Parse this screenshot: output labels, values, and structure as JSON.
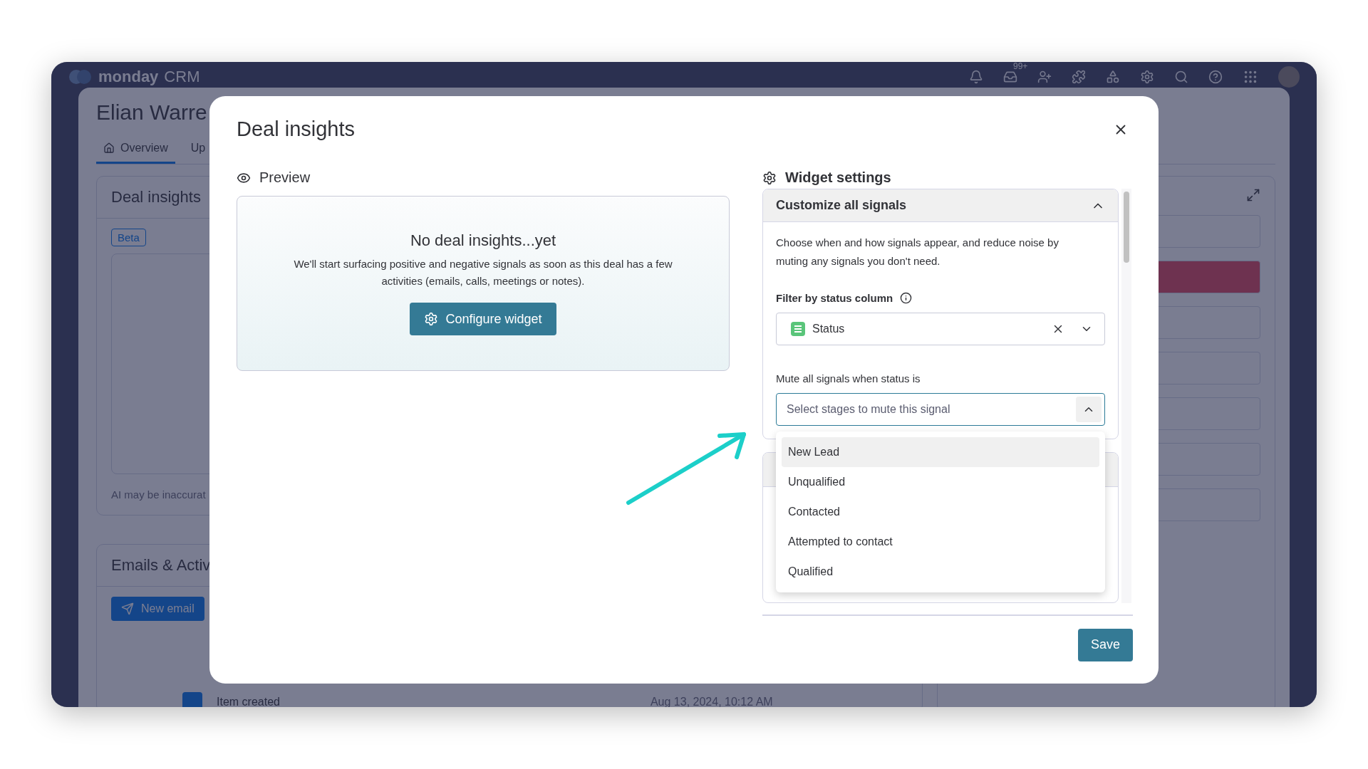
{
  "app": {
    "logo": "monday",
    "product": "CRM",
    "notification_count": "99+",
    "item_title": "Elian Warre",
    "tabs": [
      {
        "label": "Overview",
        "selected": true
      },
      {
        "label": "Up",
        "selected": false
      }
    ],
    "deal_card": {
      "title": "Deal insights",
      "badge": "Beta",
      "disclaimer": "AI may be inaccurat"
    },
    "emails_card": {
      "title": "Emails & Activ",
      "button": "New email",
      "activity": {
        "text": "Item created",
        "time": "Aug 13, 2024, 10:12 AM"
      }
    }
  },
  "modal": {
    "title": "Deal insights",
    "preview": {
      "label": "Preview",
      "empty_title": "No deal insights...yet",
      "empty_text": "We'll start surfacing positive and negative signals as soon as this deal has a few activities (emails, calls, meetings or notes).",
      "button": "Configure widget"
    },
    "settings": {
      "label": "Widget settings",
      "section": {
        "title": "Customize all signals",
        "expanded": true,
        "description": "Choose when and how signals appear, and reduce noise by muting any signals you don't need.",
        "filter": {
          "label": "Filter by status column",
          "value": "Status"
        },
        "mute": {
          "label": "Mute all signals when status is",
          "placeholder": "Select stages to mute this signal",
          "open": true,
          "options": [
            {
              "label": "New Lead",
              "highlighted": true
            },
            {
              "label": "Unqualified",
              "highlighted": false
            },
            {
              "label": "Contacted",
              "highlighted": false
            },
            {
              "label": "Attempted to contact",
              "highlighted": false
            },
            {
              "label": "Qualified",
              "highlighted": false
            }
          ]
        }
      }
    },
    "save": "Save"
  }
}
